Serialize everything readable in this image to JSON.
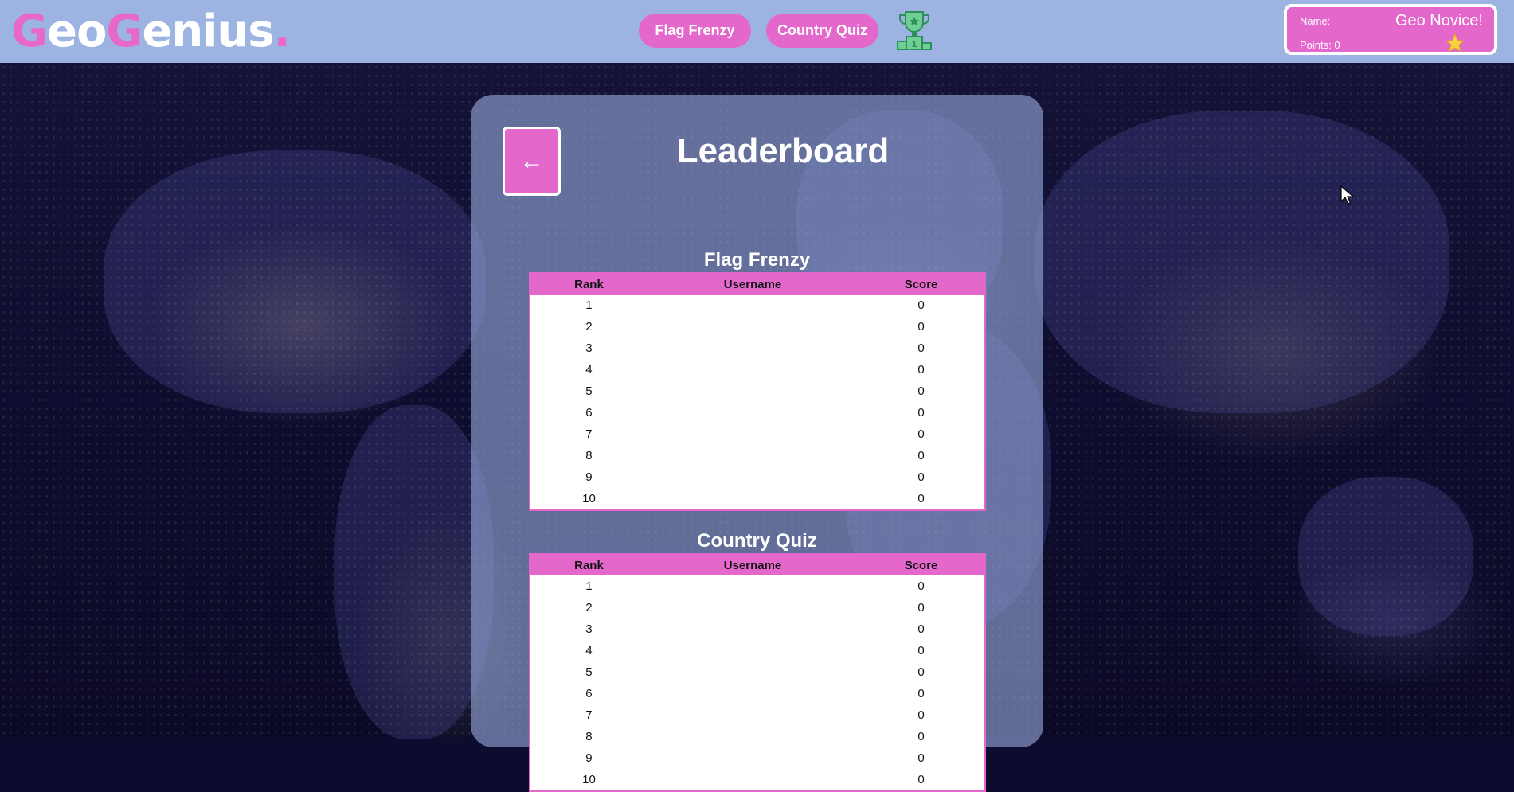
{
  "header": {
    "logo": {
      "g1": "G",
      "eo": "eo",
      "g2": "G",
      "enius": "enius",
      "dot": "."
    },
    "nav": {
      "flag_frenzy": "Flag Frenzy",
      "country_quiz": "Country Quiz"
    },
    "trophy_icon": "trophy-icon"
  },
  "user": {
    "name_label": "Name:",
    "points_label": "Points: 0",
    "title": "Geo Novice!",
    "star_icon": "star-icon"
  },
  "panel": {
    "back_label": "←",
    "title": "Leaderboard"
  },
  "columns": {
    "rank": "Rank",
    "username": "Username",
    "score": "Score"
  },
  "leaderboards": [
    {
      "title": "Flag Frenzy",
      "rows": [
        {
          "rank": "1",
          "username": "",
          "score": "0"
        },
        {
          "rank": "2",
          "username": "",
          "score": "0"
        },
        {
          "rank": "3",
          "username": "",
          "score": "0"
        },
        {
          "rank": "4",
          "username": "",
          "score": "0"
        },
        {
          "rank": "5",
          "username": "",
          "score": "0"
        },
        {
          "rank": "6",
          "username": "",
          "score": "0"
        },
        {
          "rank": "7",
          "username": "",
          "score": "0"
        },
        {
          "rank": "8",
          "username": "",
          "score": "0"
        },
        {
          "rank": "9",
          "username": "",
          "score": "0"
        },
        {
          "rank": "10",
          "username": "",
          "score": "0"
        }
      ]
    },
    {
      "title": "Country Quiz",
      "rows": [
        {
          "rank": "1",
          "username": "",
          "score": "0"
        },
        {
          "rank": "2",
          "username": "",
          "score": "0"
        },
        {
          "rank": "3",
          "username": "",
          "score": "0"
        },
        {
          "rank": "4",
          "username": "",
          "score": "0"
        },
        {
          "rank": "5",
          "username": "",
          "score": "0"
        },
        {
          "rank": "6",
          "username": "",
          "score": "0"
        },
        {
          "rank": "7",
          "username": "",
          "score": "0"
        },
        {
          "rank": "8",
          "username": "",
          "score": "0"
        },
        {
          "rank": "9",
          "username": "",
          "score": "0"
        },
        {
          "rank": "10",
          "username": "",
          "score": "0"
        }
      ]
    }
  ],
  "colors": {
    "accent": "#e468cc",
    "header_bg": "#9db3e2",
    "panel_bg": "#96aadc"
  }
}
